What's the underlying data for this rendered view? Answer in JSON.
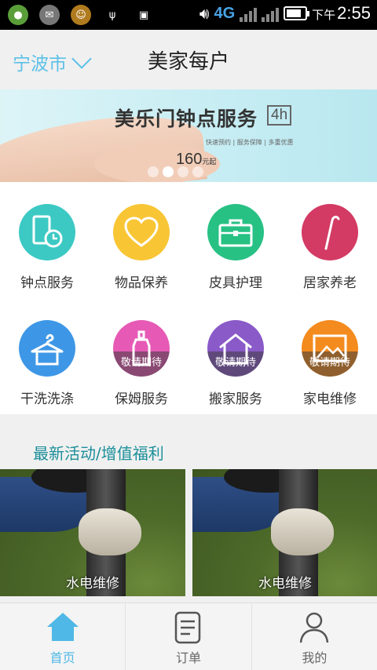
{
  "status_bar": {
    "network": "4G",
    "network_small": "4G",
    "time_prefix": "下午",
    "time": "2:55"
  },
  "header": {
    "city": "宁波市",
    "title": "美家每户"
  },
  "banner": {
    "title": "美乐门钟点服务",
    "badge": "4h",
    "subtitle": "快速预约 | 服务保障 | 多重优惠",
    "price": "160",
    "price_unit": "元起",
    "slide_count": 4,
    "active_slide": 2
  },
  "services": [
    {
      "label": "钟点服务",
      "color": "#3cc9c4",
      "icon": "clock-phone-icon",
      "overlay": ""
    },
    {
      "label": "物品保养",
      "color": "#f8c534",
      "icon": "heart-icon",
      "overlay": ""
    },
    {
      "label": "皮具护理",
      "color": "#27c184",
      "icon": "briefcase-icon",
      "overlay": ""
    },
    {
      "label": "居家养老",
      "color": "#d33a64",
      "icon": "cane-icon",
      "overlay": ""
    },
    {
      "label": "干洗洗涤",
      "color": "#3e97e6",
      "icon": "hanger-icon",
      "overlay": ""
    },
    {
      "label": "保姆服务",
      "color": "#e65ab6",
      "icon": "bottle-icon",
      "overlay": "敬请期待"
    },
    {
      "label": "搬家服务",
      "color": "#8a5ac8",
      "icon": "house-icon",
      "overlay": "敬请期待"
    },
    {
      "label": "家电维修",
      "color": "#f48b1e",
      "icon": "picture-icon",
      "overlay": "敬请期待"
    }
  ],
  "activities": {
    "title": "最新活动/增值福利",
    "cards": [
      {
        "caption": "水电维修"
      },
      {
        "caption": "水电维修"
      }
    ]
  },
  "bottom_nav": [
    {
      "label": "首页",
      "icon": "home-icon",
      "active": true
    },
    {
      "label": "订单",
      "icon": "order-icon",
      "active": false
    },
    {
      "label": "我的",
      "icon": "user-icon",
      "active": false
    }
  ]
}
